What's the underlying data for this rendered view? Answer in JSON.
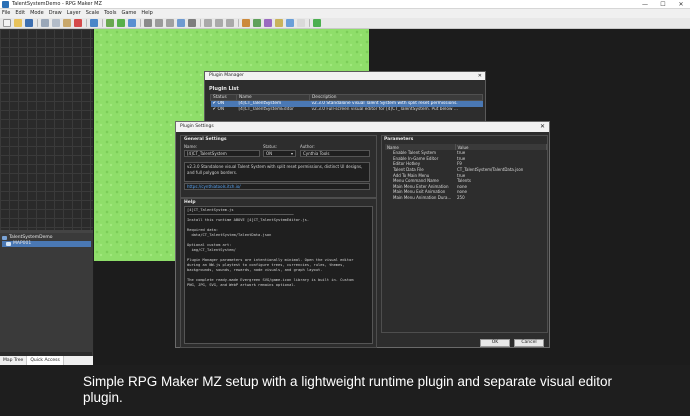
{
  "window": {
    "title": "TalentSystemDemo - RPG Maker MZ",
    "controls": [
      "—",
      "☐",
      "✕"
    ]
  },
  "menu": [
    "File",
    "Edit",
    "Mode",
    "Draw",
    "Layer",
    "Scale",
    "Tools",
    "Game",
    "Help"
  ],
  "map_tree": {
    "items": [
      {
        "label": "TalentSystemDemo"
      },
      {
        "label": "MAP001"
      }
    ],
    "tabs": [
      "Map Tree",
      "Quick Access"
    ]
  },
  "plugin_manager": {
    "title": "Plugin Manager",
    "section": "Plugin List",
    "columns": [
      "Status",
      "Name",
      "Description"
    ],
    "rows": [
      {
        "check": "✔",
        "status": "ON",
        "name": "[4]CT_TalentSystem",
        "desc": "v2.3.0 Standalone visual Talent System with split reset permissions."
      },
      {
        "check": "✔",
        "status": "ON",
        "name": "[4]CT_TalentSystemEditor",
        "desc": "v2.3.0 Full-screen visual editor for [4]CT_TalentSystem. Put below ..."
      }
    ]
  },
  "plugin_settings": {
    "title": "Plugin Settings",
    "general": {
      "heading": "General Settings",
      "name_label": "Name:",
      "name_value": "[4]CT_TalentSystem",
      "status_label": "Status:",
      "status_value": "ON",
      "author_label": "Author:",
      "author_value": "Cynthia Tools",
      "description": "v2.3.0 Standalone visual Talent System with split reset permissions, distinct UI designs, and full polygon borders.",
      "link": "https://cynthiatools.itch.io/"
    },
    "help": {
      "heading": "Help",
      "lines": [
        "[4]CT_TalentSystem.js",
        "────────────────────────────────────────────────",
        "Install this runtime ABOVE [4]CT_TalentSystemEditor.js.",
        "",
        "Required data:",
        "  data/CT_TalentSystem/TalentData.json",
        "",
        "Optional custom art:",
        "  img/CT_TalentSystem/",
        "",
        "Plugin Manager parameters are intentionally minimal. Open the visual editor",
        "during an NW.js playtest to configure trees, currencies, rules, themes,",
        "backgrounds, sounds, rewards, node visuals, and graph layout.",
        "",
        "The complete ready-made Evergreen SVG/game-icon library is built in. Custom",
        "PNG, JPG, SVG, and WebP artwork remains optional."
      ]
    },
    "parameters": {
      "heading": "Parameters",
      "columns": [
        "Name",
        "Value"
      ],
      "rows": [
        {
          "name": "Enable Talent System",
          "value": "true"
        },
        {
          "name": "Enable In-Game Editor",
          "value": "true"
        },
        {
          "name": "Editor Hotkey",
          "value": "F9"
        },
        {
          "name": "Talent Data File",
          "value": "CT_TalentSystem/TalentData.json"
        },
        {
          "name": "Add To Main Menu",
          "value": "true"
        },
        {
          "name": "Menu Command Name",
          "value": "Talents"
        },
        {
          "name": "Main Menu Enter Animation",
          "value": "none"
        },
        {
          "name": "Main Menu Exit Animation",
          "value": "none"
        },
        {
          "name": "Main Menu Animation Dura...",
          "value": "250"
        }
      ]
    },
    "ok_label": "OK",
    "cancel_label": "Cancel"
  },
  "caption": "Simple RPG Maker MZ setup with a lightweight runtime plugin and separate visual editor plugin.",
  "colors": {
    "selection": "#4a78b4",
    "grass": "#8fde6a",
    "panel": "#2d2d2d",
    "link": "#5aa6f5"
  }
}
